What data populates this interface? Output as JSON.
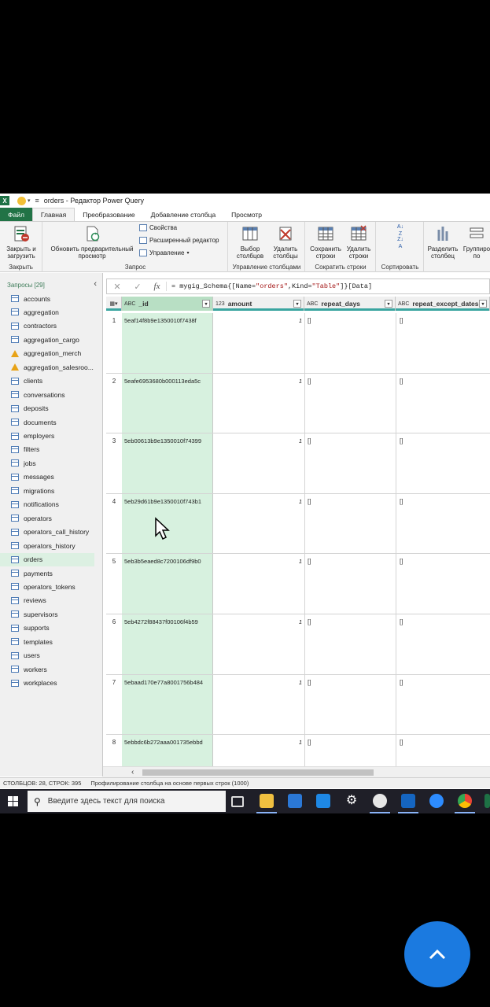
{
  "titlebar": {
    "app_logo": "X",
    "title": "orders - Редактор Power Query"
  },
  "tabs": [
    "Файл",
    "Главная",
    "Преобразование",
    "Добавление столбца",
    "Просмотр"
  ],
  "ribbon": {
    "close_load": "Закрыть и загрузить",
    "close_group": "Закрыть",
    "refresh_preview": "Обновить предварительный просмотр",
    "properties": "Свойства",
    "advanced_editor": "Расширенный редактор",
    "manage": "Управление",
    "query_group": "Запрос",
    "choose_columns": "Выбор столбцов",
    "remove_columns": "Удалить столбцы",
    "manage_columns_group": "Управление столбцами",
    "keep_rows": "Сохранить строки",
    "remove_rows": "Удалить строки",
    "reduce_rows_group": "Сократить строки",
    "sort_group": "Сортировать",
    "split_column": "Разделить столбец",
    "group_by": "Группиро по"
  },
  "queries": {
    "header": "Запросы [29]",
    "items": [
      {
        "label": "accounts",
        "icon": "table-icon"
      },
      {
        "label": "aggregation",
        "icon": "table-icon"
      },
      {
        "label": "contractors",
        "icon": "table-icon"
      },
      {
        "label": "aggregation_cargo",
        "icon": "table-icon"
      },
      {
        "label": "aggregation_merch",
        "icon": "warning-icon"
      },
      {
        "label": "aggregation_salesroo...",
        "icon": "warning-icon"
      },
      {
        "label": "clients",
        "icon": "table-icon"
      },
      {
        "label": "conversations",
        "icon": "table-icon"
      },
      {
        "label": "deposits",
        "icon": "table-icon"
      },
      {
        "label": "documents",
        "icon": "table-icon"
      },
      {
        "label": "employers",
        "icon": "table-icon"
      },
      {
        "label": "filters",
        "icon": "table-icon"
      },
      {
        "label": "jobs",
        "icon": "table-icon"
      },
      {
        "label": "messages",
        "icon": "table-icon"
      },
      {
        "label": "migrations",
        "icon": "table-icon"
      },
      {
        "label": "notifications",
        "icon": "table-icon"
      },
      {
        "label": "operators",
        "icon": "table-icon"
      },
      {
        "label": "operators_call_history",
        "icon": "table-icon"
      },
      {
        "label": "operators_history",
        "icon": "table-icon"
      },
      {
        "label": "orders",
        "icon": "table-icon",
        "selected": true
      },
      {
        "label": "payments",
        "icon": "table-icon"
      },
      {
        "label": "operators_tokens",
        "icon": "table-icon"
      },
      {
        "label": "reviews",
        "icon": "table-icon"
      },
      {
        "label": "supervisors",
        "icon": "table-icon"
      },
      {
        "label": "supports",
        "icon": "table-icon"
      },
      {
        "label": "templates",
        "icon": "table-icon"
      },
      {
        "label": "users",
        "icon": "table-icon"
      },
      {
        "label": "workers",
        "icon": "table-icon"
      },
      {
        "label": "workplaces",
        "icon": "table-icon"
      }
    ]
  },
  "formula": {
    "cancel": "✕",
    "accept": "✓",
    "fx": "fx",
    "prefix": "= mygig_Schema{[Name=",
    "name_str": "\"orders\"",
    "mid": ",Kind=",
    "kind_str": "\"Table\"",
    "suffix": "]}[Data]"
  },
  "grid": {
    "columns": [
      {
        "type": "ABC",
        "name": "_id"
      },
      {
        "type": "123",
        "name": "amount"
      },
      {
        "type": "ABC",
        "name": "repeat_days"
      },
      {
        "type": "ABC",
        "name": "repeat_except_dates"
      }
    ],
    "rows": [
      {
        "n": "1",
        "id": "5eaf14f8b9e1350010f7438f",
        "amount": "1",
        "repeat_days": "[]",
        "repeat_except_dates": "[]"
      },
      {
        "n": "2",
        "id": "5eafe6953680b000113eda5c",
        "amount": "1",
        "repeat_days": "[]",
        "repeat_except_dates": "[]"
      },
      {
        "n": "3",
        "id": "5eb00613b9e1350010f74399",
        "amount": "1",
        "repeat_days": "[]",
        "repeat_except_dates": "[]"
      },
      {
        "n": "4",
        "id": "5eb29d61b9e1350010f743b1",
        "amount": "1",
        "repeat_days": "[]",
        "repeat_except_dates": "[]"
      },
      {
        "n": "5",
        "id": "5eb3b5eaed8c7200106df9b0",
        "amount": "1",
        "repeat_days": "[]",
        "repeat_except_dates": "[]"
      },
      {
        "n": "6",
        "id": "5eb4272f88437f00106f4b59",
        "amount": "1",
        "repeat_days": "[]",
        "repeat_except_dates": "[]"
      },
      {
        "n": "7",
        "id": "5ebaad170e77a8001756b484",
        "amount": "1",
        "repeat_days": "[]",
        "repeat_except_dates": "[]"
      },
      {
        "n": "8",
        "id": "5ebbdc6b272aaa001735ebbd",
        "amount": "1",
        "repeat_days": "[]",
        "repeat_except_dates": "[]"
      }
    ]
  },
  "status": {
    "counts": "СТОЛБЦОВ: 28, СТРОК: 395",
    "profiling": "Профилирование столбца на основе первых строк (1000)"
  },
  "taskbar": {
    "search_placeholder": "Введите здесь текст для поиска"
  },
  "colors": {
    "excel_green": "#217346",
    "id_column": "#d7f1df",
    "accent_teal": "#3aa5a0",
    "fab_blue": "#1b7ae0"
  }
}
